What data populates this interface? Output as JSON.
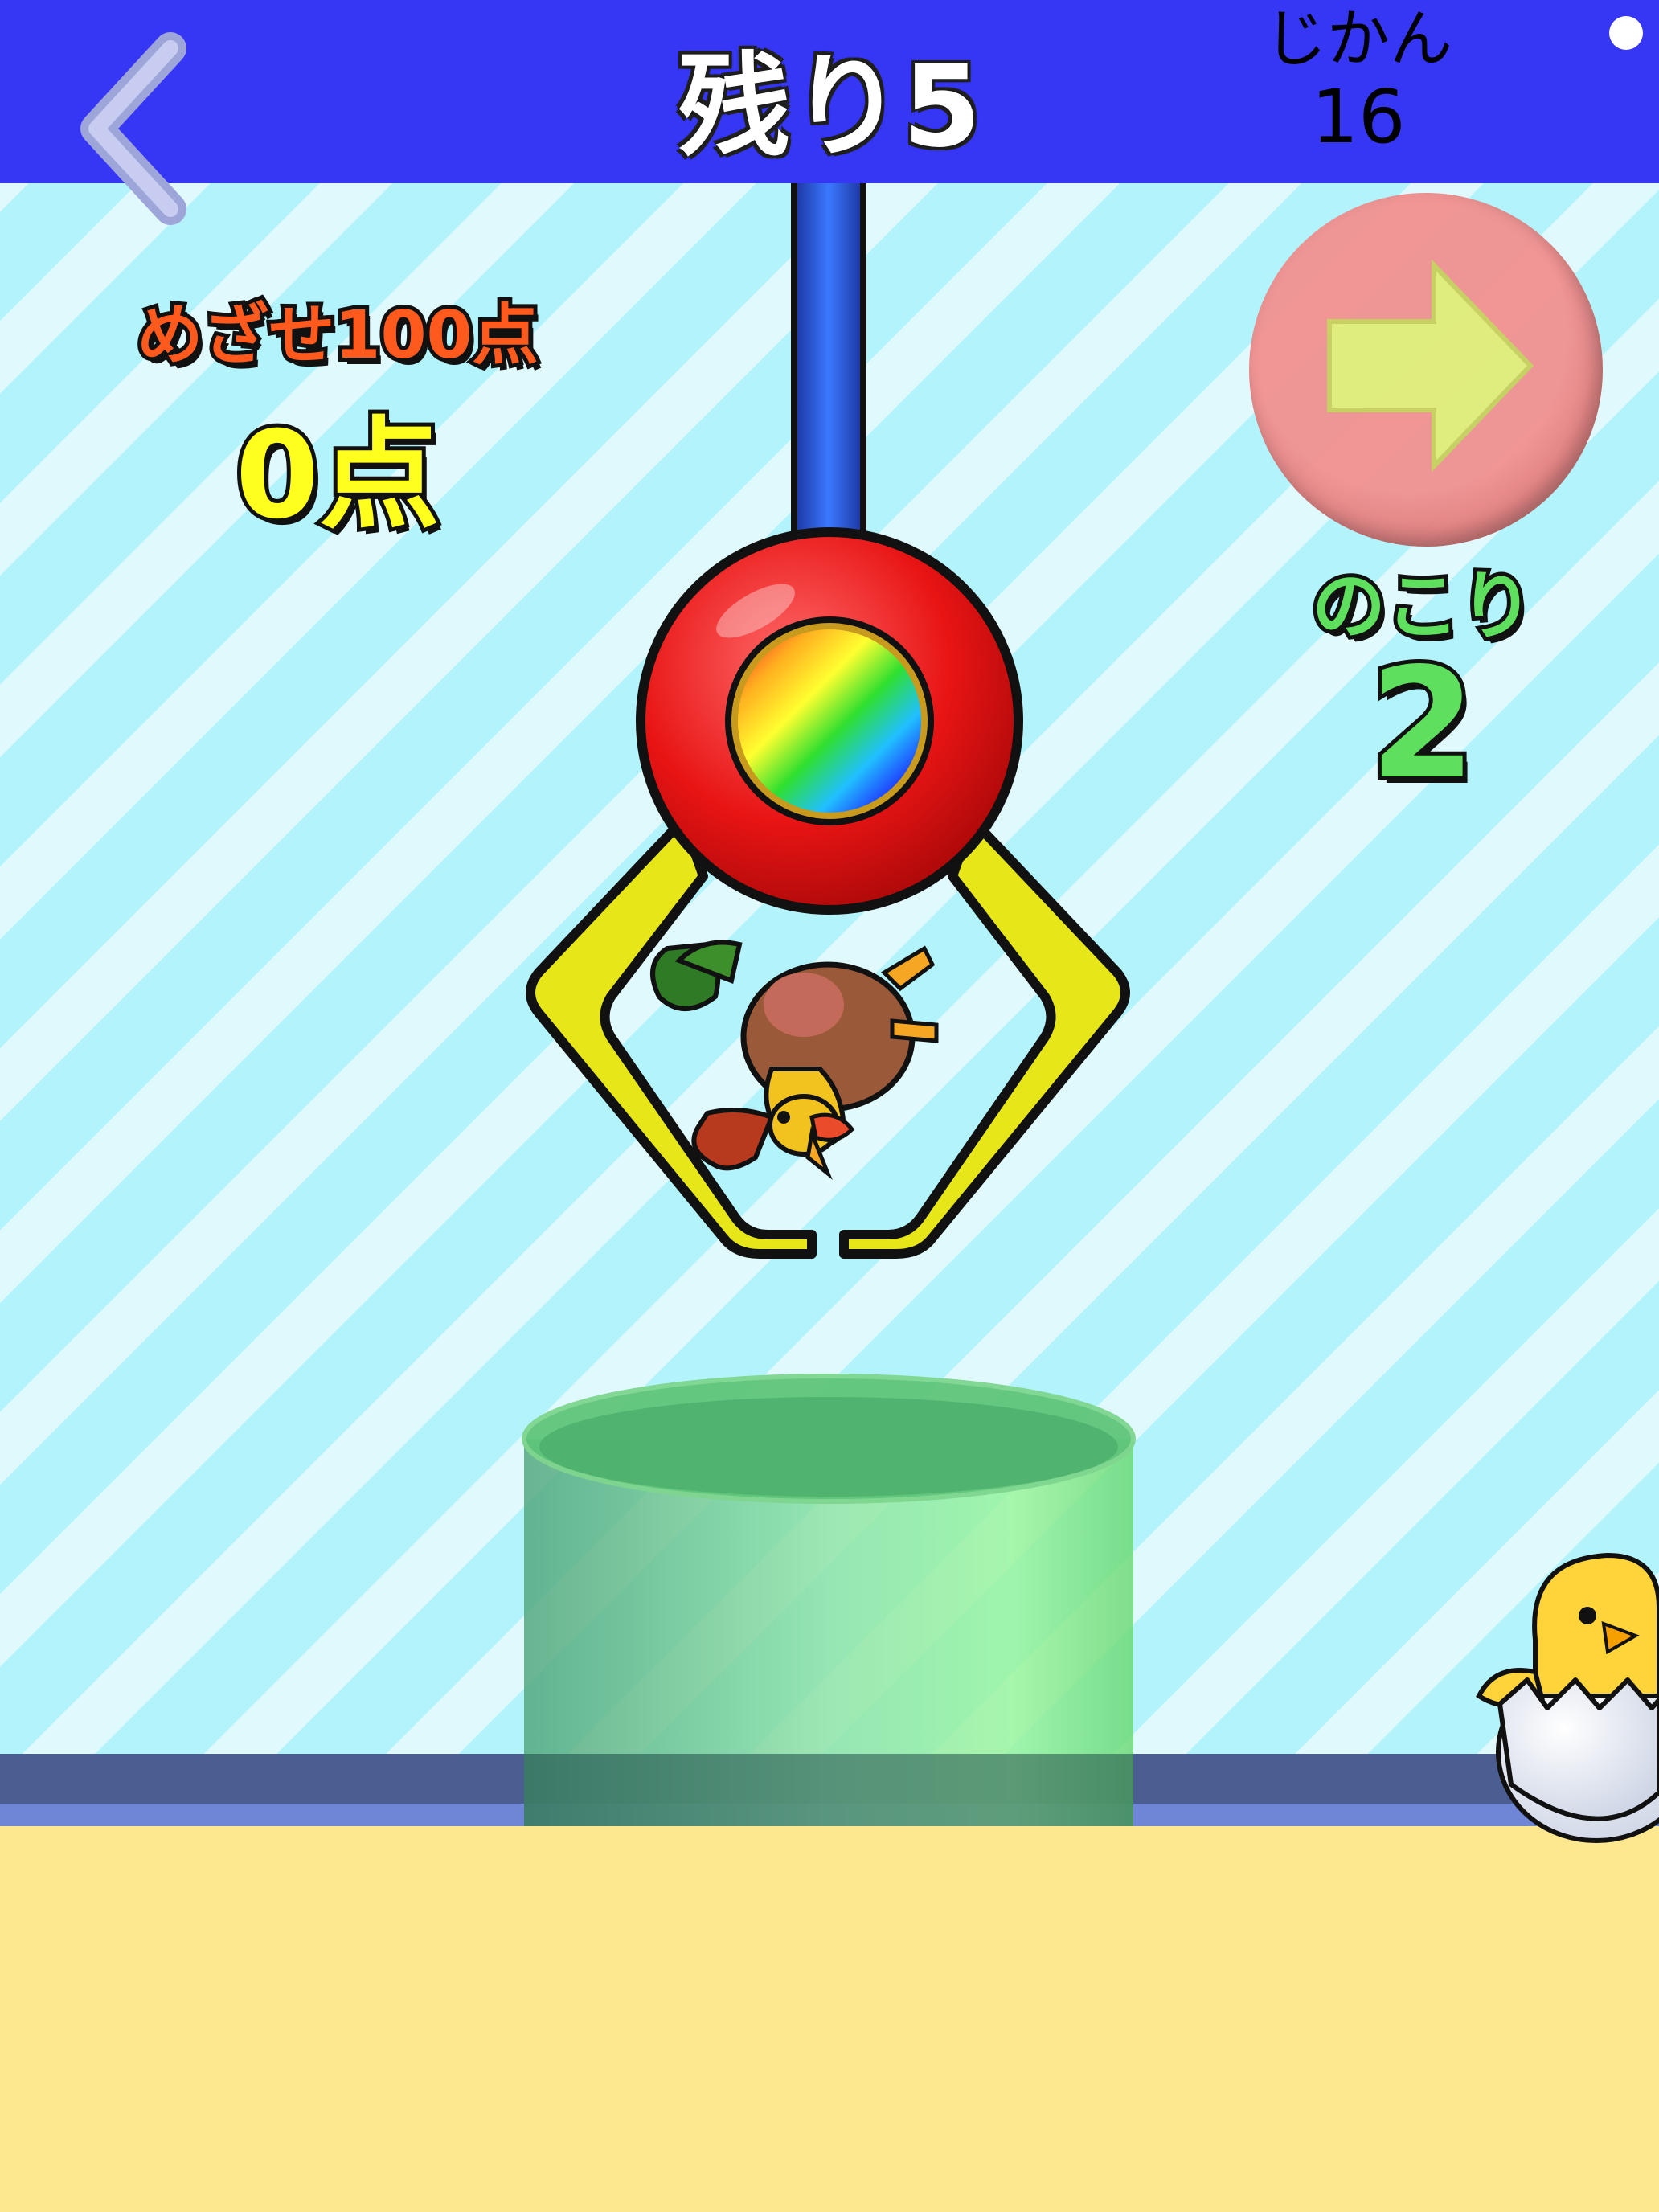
{
  "header": {
    "title": "残り5",
    "timer_label": "じかん",
    "timer_value": "16",
    "back_icon": "chevron-left-icon"
  },
  "hud": {
    "goal_label": "めざせ100点",
    "score": "0点",
    "remaining_label": "のこり",
    "remaining_value": "2",
    "next_icon": "arrow-right-icon"
  },
  "scene": {
    "held_item": "rooster",
    "bystander": "chick-in-egg"
  },
  "colors": {
    "header": "#3636f5",
    "goal_label": "#ff5a1e",
    "score": "#ffff1e",
    "remaining": "#5ee05e",
    "claw_arms": "#e6e619",
    "claw_hub": "#e81414",
    "cup": "#6fd88b",
    "ground": "#fde78f"
  }
}
